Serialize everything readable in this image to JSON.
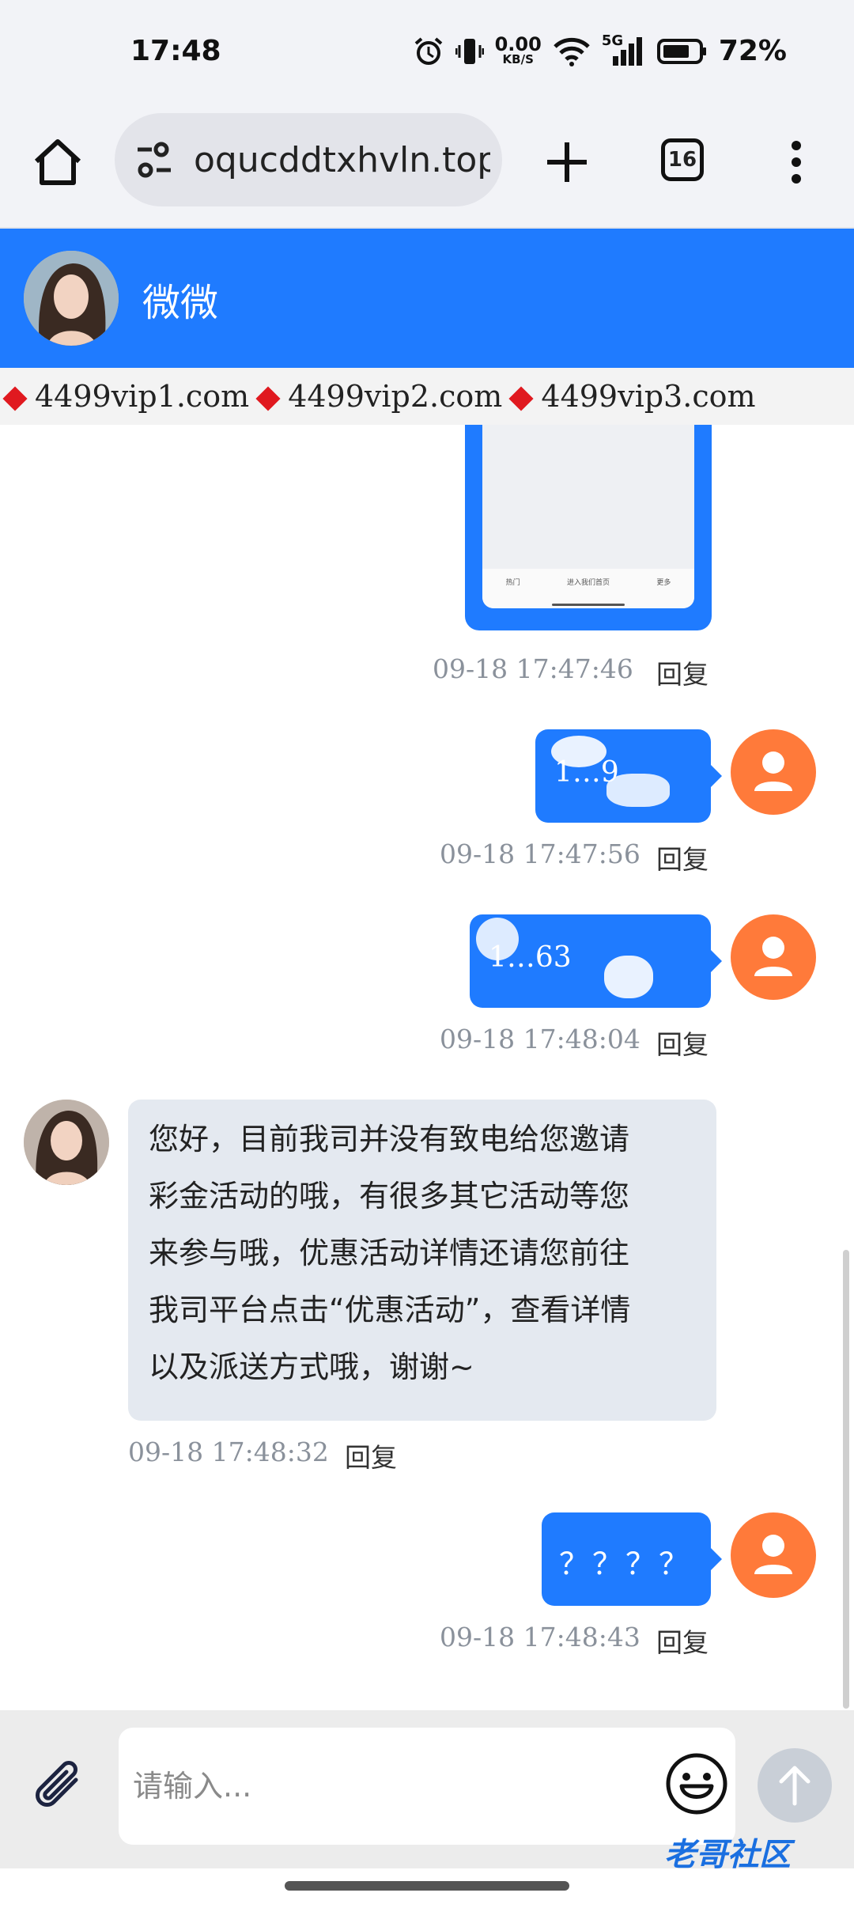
{
  "status_bar": {
    "time": "17:48",
    "network_speed_value": "0.00",
    "network_speed_unit": "KB/S",
    "network_type": "5G",
    "battery": "72%"
  },
  "browser": {
    "url": "oqucddtxhvln.top",
    "tab_count": "16"
  },
  "chat": {
    "agent_name": "微微",
    "marquee_domains": [
      "4499vip1.com",
      "4499vip2.com",
      "4499vip3.com"
    ],
    "reply_label": "回复",
    "messages": [
      {
        "timestamp": "09-18 17:47:46"
      },
      {
        "from": "user",
        "text": "1…9",
        "timestamp": "09-18 17:47:56"
      },
      {
        "from": "user",
        "text": "1…63",
        "timestamp": "09-18 17:48:04"
      },
      {
        "from": "agent",
        "lines": [
          "您好，目前我司并没有致电给您邀请",
          "彩金活动的哦，有很多其它活动等您",
          "来参与哦，优惠活动详情还请您前往",
          "我司平台点击“优惠活动”，查看详情",
          "以及派送方式哦，谢谢~"
        ],
        "timestamp": "09-18 17:48:32"
      },
      {
        "from": "user",
        "text": "？？？？",
        "timestamp": "09-18 17:48:43"
      }
    ],
    "preview_tabs": [
      "热门",
      "进入我们首页",
      "更多"
    ]
  },
  "composer": {
    "placeholder": "请输入..."
  },
  "watermark": "老哥社区",
  "colors": {
    "header_blue": "#1f7bff",
    "user_avatar": "#ff7a3a",
    "agent_bubble": "#e4e9f0"
  }
}
